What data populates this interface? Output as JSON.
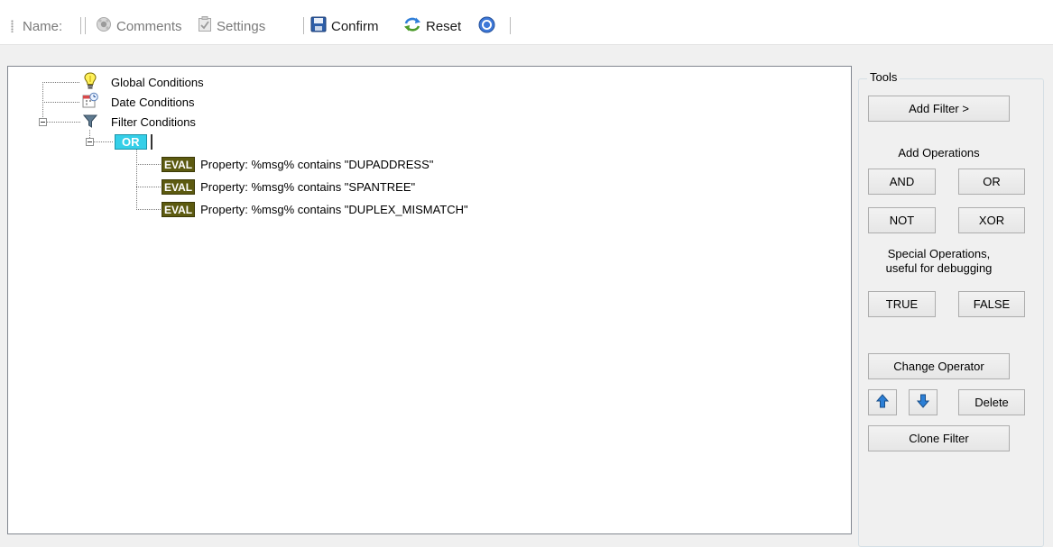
{
  "toolbar": {
    "name_label": "Name:",
    "comments_label": "Comments",
    "settings_label": "Settings",
    "confirm_label": "Confirm",
    "reset_label": "Reset"
  },
  "tree": {
    "global_conditions": "Global Conditions",
    "date_conditions": "Date Conditions",
    "filter_conditions": "Filter Conditions",
    "or_tag": "OR",
    "eval_tag": "EVAL",
    "rules": [
      "Property: %msg% contains \"DUPADDRESS\"",
      "Property: %msg% contains \"SPANTREE\"",
      "Property: %msg% contains \"DUPLEX_MISMATCH\""
    ]
  },
  "tools": {
    "title": "Tools",
    "add_filter": "Add Filter >",
    "add_operations": "Add Operations",
    "and": "AND",
    "or": "OR",
    "not": "NOT",
    "xor": "XOR",
    "special_line1": "Special Operations,",
    "special_line2": "useful for debugging",
    "true": "TRUE",
    "false": "FALSE",
    "change_operator": "Change Operator",
    "delete": "Delete",
    "clone_filter": "Clone Filter"
  },
  "colors": {
    "or_tag": "#35cfe8",
    "eval_tag": "#5c5a10"
  },
  "icons": {
    "comments": "comments-icon",
    "settings": "settings-icon",
    "confirm": "save-icon",
    "reset": "reset-icon",
    "help": "help-icon",
    "global": "lightbulb-icon",
    "date": "calendar-icon",
    "filter": "funnel-icon",
    "move_up": "arrow-up-icon",
    "move_down": "arrow-down-icon"
  }
}
